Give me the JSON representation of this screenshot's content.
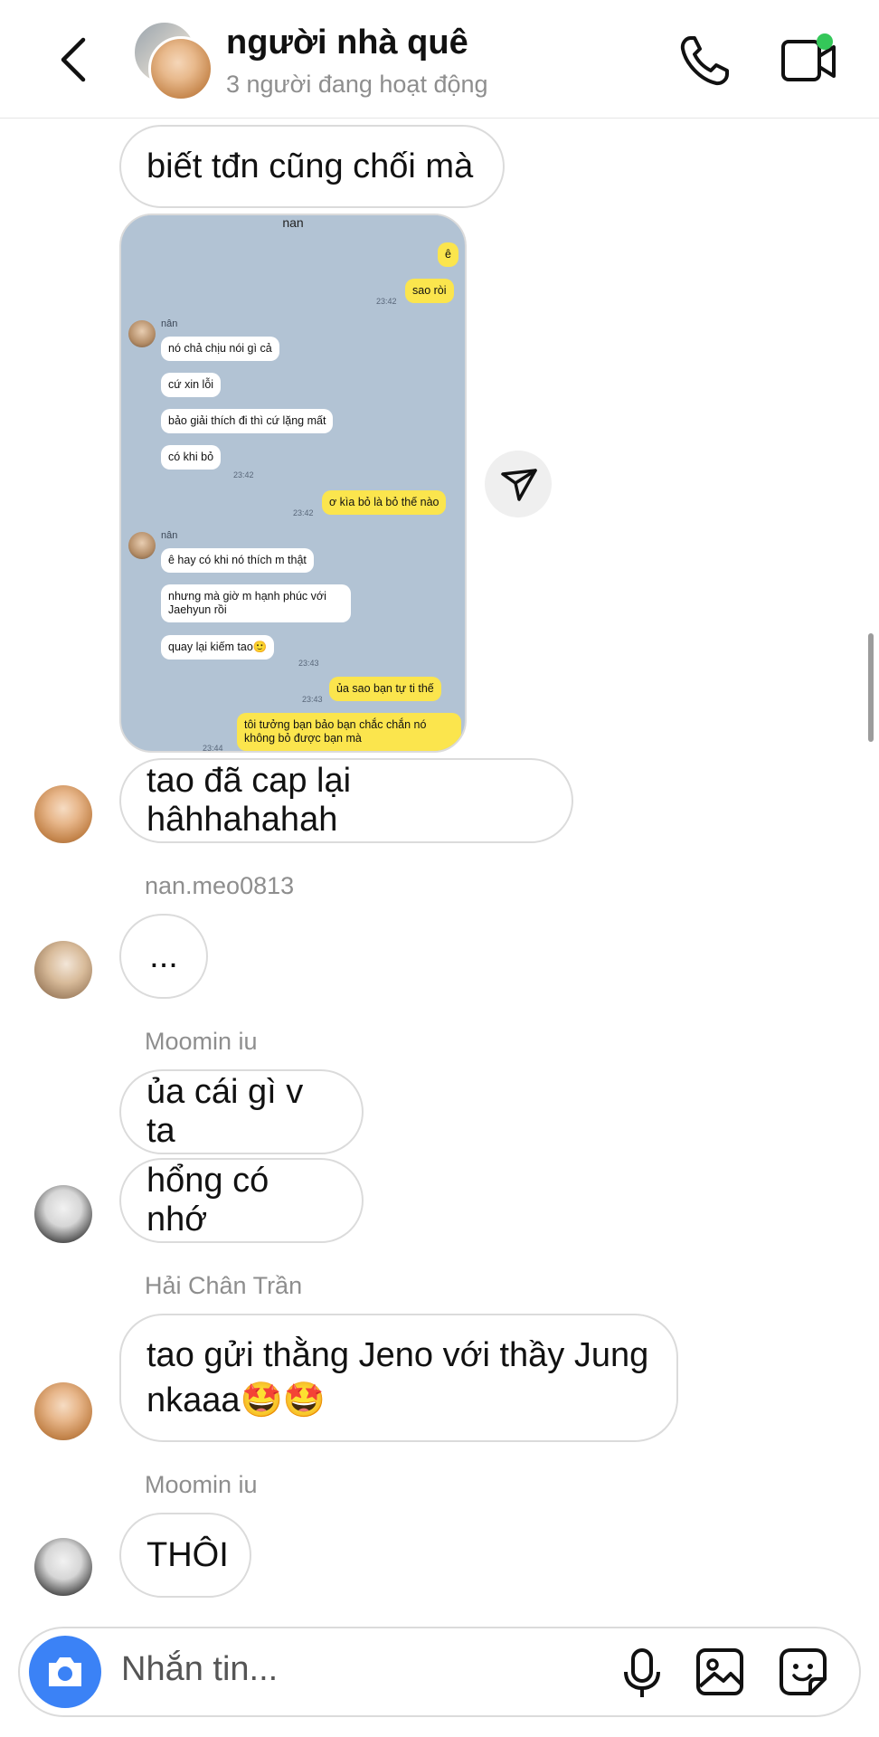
{
  "header": {
    "title": "người nhà quê",
    "subtitle": "3 người đang hoạt động"
  },
  "messages": {
    "m1": "biết tđn cũng chối mà",
    "m2": "tao đã cap lại hâhhahahah",
    "m3_sender": "nan.meo0813",
    "m3": "...",
    "m4_sender": "Moomin iu",
    "m4": "ủa cái gì v ta",
    "m5": "hổng có nhớ",
    "m6_sender": "Hải Chân Trần",
    "m6_line1": "tao gửi thằng Jeno với thầy Jung",
    "m6_line2": "nkaaa🤩🤩",
    "m7_sender": "Moomin iu",
    "m7": "THÔI"
  },
  "screenshot": {
    "title": "nan",
    "contact": "nân",
    "bubbles": [
      "ê",
      "sao ròi",
      "nó chả chịu nói gì cả",
      "cứ xin lỗi",
      "bảo giải thích đi thì cứ lặng mất",
      "có khi bỏ",
      "ơ kìa bỏ là bỏ thế nào",
      "ê hay có khi nó thích m thật",
      "nhưng mà giờ m hạnh phúc với",
      "Jaehyun rồi",
      "quay lại kiếm tao🙂",
      "ủa sao bạn tự ti thế",
      "tôi tưởng bạn bảo bạn chắc chắn nó",
      "không bỏ được bạn mà"
    ],
    "times": [
      "23:42",
      "23:42",
      "23:42",
      "23:43",
      "23:43",
      "23:44"
    ]
  },
  "composer": {
    "placeholder": "Nhắn tin..."
  },
  "colors": {
    "accent": "#3b82f6",
    "online": "#34c759",
    "bubble_border": "#dbdbdb"
  }
}
